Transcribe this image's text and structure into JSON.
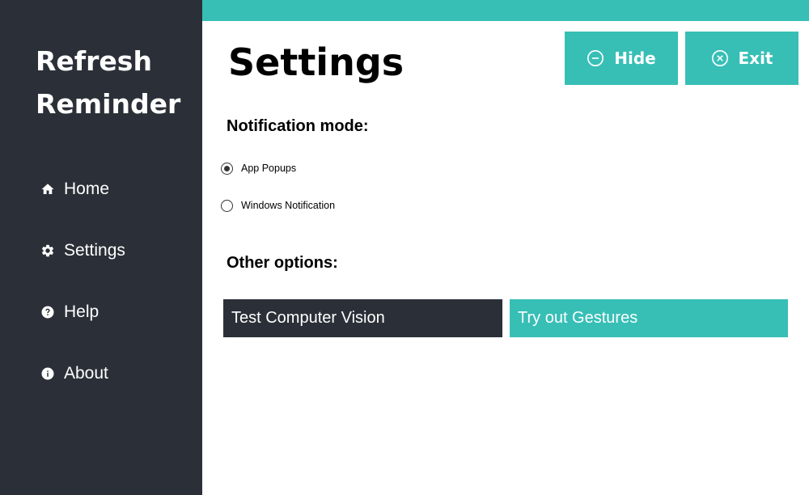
{
  "app": {
    "title_line1": "Refresh",
    "title_line2": "Reminder"
  },
  "sidebar": {
    "items": [
      {
        "label": "Home",
        "icon": "home-icon"
      },
      {
        "label": "Settings",
        "icon": "gear-icon"
      },
      {
        "label": "Help",
        "icon": "help-icon"
      },
      {
        "label": "About",
        "icon": "info-icon"
      }
    ]
  },
  "header": {
    "title": "Settings",
    "hide_label": "Hide",
    "exit_label": "Exit"
  },
  "notification": {
    "heading": "Notification mode:",
    "options": [
      {
        "label": "App Popups",
        "selected": true
      },
      {
        "label": "Windows Notification",
        "selected": false
      }
    ]
  },
  "other": {
    "heading": "Other options:",
    "test_cv_label": "Test Computer Vision",
    "gestures_label": "Try out Gestures"
  },
  "colors": {
    "accent": "#37bfb6",
    "sidebar": "#2b3038",
    "background": "#ffffff"
  }
}
